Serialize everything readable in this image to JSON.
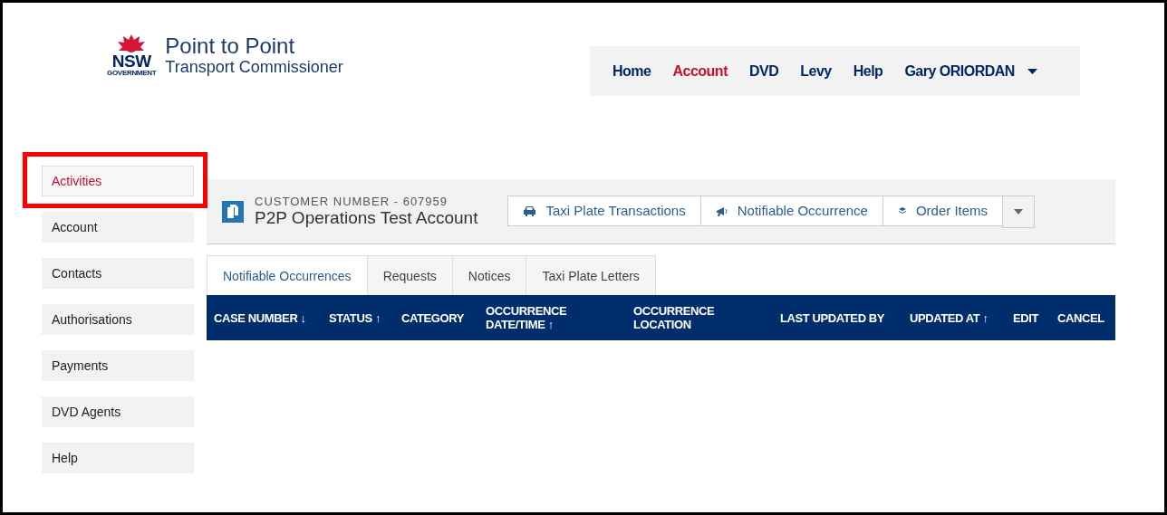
{
  "brand": {
    "emblem": "NSW",
    "emblem_sub": "GOVERNMENT",
    "title": "Point to Point",
    "subtitle": "Transport Commissioner"
  },
  "nav": [
    {
      "label": "Home",
      "selected": false
    },
    {
      "label": "Account",
      "selected": true
    },
    {
      "label": "DVD",
      "selected": false
    },
    {
      "label": "Levy",
      "selected": false
    },
    {
      "label": "Help",
      "selected": false
    },
    {
      "label": "Gary ORIORDAN",
      "selected": false,
      "kind": "user"
    }
  ],
  "sidebar": {
    "items": [
      {
        "label": "Activities",
        "selected": true,
        "highlighted": true
      },
      {
        "label": "Account",
        "selected": false,
        "highlighted": false
      },
      {
        "label": "Contacts",
        "selected": false,
        "highlighted": false
      },
      {
        "label": "Authorisations",
        "selected": false,
        "highlighted": false
      },
      {
        "label": "Payments",
        "selected": false,
        "highlighted": false
      },
      {
        "label": "DVD Agents",
        "selected": false,
        "highlighted": false
      },
      {
        "label": "Help",
        "selected": false,
        "highlighted": false
      }
    ]
  },
  "account": {
    "customer_number": "CUSTOMER NUMBER - 607959",
    "name": "P2P Operations Test Account",
    "actions": [
      {
        "label": "Taxi Plate Transactions",
        "kind": "car"
      },
      {
        "label": "Notifiable Occurrence",
        "kind": "megaphone"
      },
      {
        "label": "Order Items",
        "kind": "stack"
      }
    ]
  },
  "tabs": [
    {
      "label": "Notifiable Occurrences",
      "selected": true
    },
    {
      "label": "Requests",
      "selected": false
    },
    {
      "label": "Notices",
      "selected": false
    },
    {
      "label": "Taxi Plate Letters",
      "selected": false
    }
  ],
  "table": {
    "columns": [
      "CASE NUMBER ↓",
      "STATUS ↑",
      "CATEGORY",
      "OCCURRENCE DATE/TIME ↑",
      "OCCURRENCE LOCATION",
      "LAST UPDATED BY",
      "UPDATED AT ↑",
      "EDIT",
      "CANCEL"
    ]
  }
}
